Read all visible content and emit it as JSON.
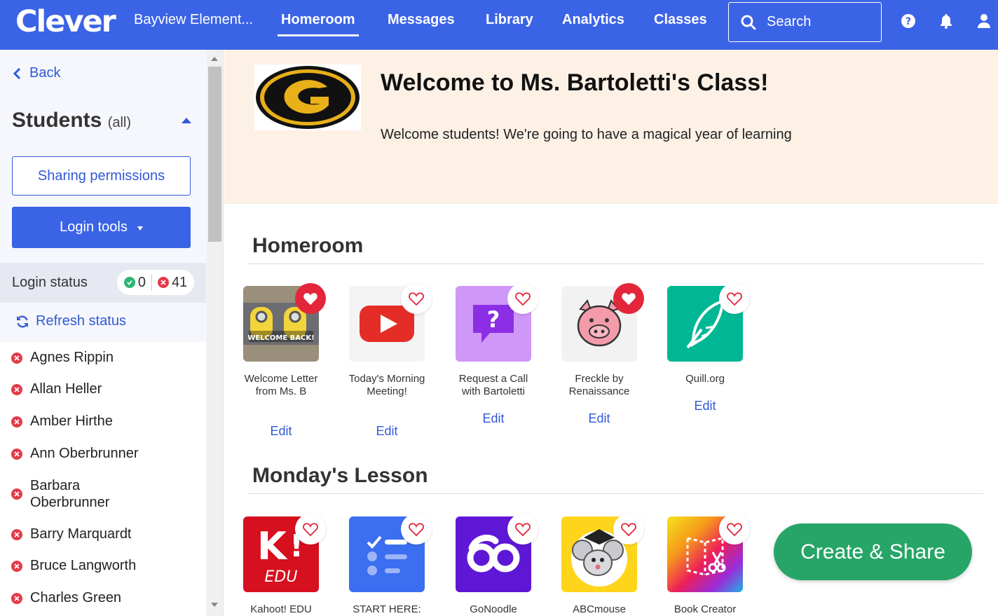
{
  "brand": {
    "logo_text": "Clever",
    "accent": "#3b63e6",
    "green": "#27a567",
    "red": "#e3263a"
  },
  "nav": {
    "school": "Bayview Element...",
    "items": [
      "Homeroom",
      "Messages",
      "Library",
      "Analytics",
      "Classes"
    ],
    "active": "Homeroom",
    "search_label": "Search",
    "icons": [
      "help-icon",
      "bell-icon",
      "user-icon"
    ]
  },
  "sidebar": {
    "back_label": "Back",
    "students_title": "Students",
    "students_filter": "(all)",
    "sharing_label": "Sharing permissions",
    "login_tools_label": "Login tools",
    "login_status_label": "Login status",
    "logged_in_count": "0",
    "logged_out_count": "41",
    "refresh_label": "Refresh status",
    "students": [
      "Agnes Rippin",
      "Allan Heller",
      "Amber Hirthe",
      "Ann Oberbrunner",
      "Barbara Oberbrunner",
      "Barry Marquardt",
      "Bruce Langworth",
      "Charles Green"
    ]
  },
  "banner": {
    "title": "Welcome to Ms. Bartoletti's Class!",
    "text": "Welcome students! We're going to have a magical year of learning"
  },
  "sections": [
    {
      "title": "Homeroom",
      "apps": [
        {
          "name": "Welcome Letter from Ms. B",
          "edit": "Edit",
          "icon": "minions-welcome-back-image",
          "tile_text": "WELCOME BACK!",
          "favorited": true
        },
        {
          "name": "Today's Morning Meeting!",
          "edit": "Edit",
          "icon": "youtube-icon",
          "favorited": false
        },
        {
          "name": "Request a Call with Bartoletti",
          "edit": "Edit",
          "icon": "question-chat-icon",
          "favorited": false
        },
        {
          "name": "Freckle by Renaissance",
          "edit": "Edit",
          "icon": "pig-icon",
          "favorited": true
        },
        {
          "name": "Quill.org",
          "edit": "Edit",
          "icon": "quill-feather-icon",
          "favorited": false
        }
      ]
    },
    {
      "title": "Monday's Lesson",
      "apps": [
        {
          "name": "Kahoot! EDU",
          "icon": "kahoot-icon",
          "tile_text": "EDU",
          "favorited": false
        },
        {
          "name": "START HERE:",
          "icon": "checklist-icon",
          "favorited": false
        },
        {
          "name": "GoNoodle",
          "icon": "gonoodle-icon",
          "favorited": false
        },
        {
          "name": "ABCmouse",
          "icon": "abcmouse-icon",
          "favorited": false
        },
        {
          "name": "Book Creator",
          "icon": "book-creator-icon",
          "favorited": false
        }
      ]
    }
  ],
  "cta": {
    "create_share_label": "Create & Share"
  }
}
